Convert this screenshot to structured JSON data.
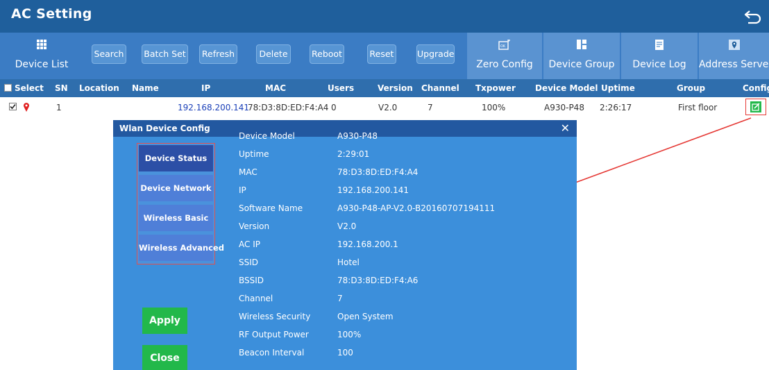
{
  "header": {
    "title": "AC Setting",
    "back_icon": "back-arrow-icon"
  },
  "toolbar": {
    "device_list": "Device List",
    "search": "Search",
    "batch_set": "Batch Set",
    "refresh": "Refresh",
    "delete": "Delete",
    "reboot": "Reboot",
    "reset": "Reset",
    "upgrade": "Upgrade",
    "zero_config": "Zero Config",
    "device_group": "Device Group",
    "device_log": "Device Log",
    "address_server": "Address Server"
  },
  "table": {
    "headers": {
      "select": "Select",
      "sn": "SN",
      "location": "Location",
      "name": "Name",
      "ip": "IP",
      "mac": "MAC",
      "users": "Users",
      "version": "Version",
      "channel": "Channel",
      "txpower": "Txpower",
      "model": "Device Model",
      "uptime": "Uptime",
      "group": "Group",
      "config": "Config"
    },
    "row": {
      "sn": "1",
      "ip": "192.168.200.141",
      "mac": "78:D3:8D:ED:F4:A4",
      "users": "0",
      "version": "V2.0",
      "channel": "7",
      "txpower": "100%",
      "model": "A930-P48",
      "uptime": "2:26:17",
      "group": "First floor"
    }
  },
  "modal": {
    "title": "Wlan Device Config",
    "close": "✕",
    "menu": [
      "Device Status",
      "Device Network",
      "Wireless Basic",
      "Wireless Advanced"
    ],
    "apply": "Apply",
    "close_btn": "Close",
    "fields": [
      {
        "label": "Device Model",
        "value": "A930-P48"
      },
      {
        "label": "Uptime",
        "value": "2:29:01"
      },
      {
        "label": "MAC",
        "value": "78:D3:8D:ED:F4:A4"
      },
      {
        "label": "IP",
        "value": "192.168.200.141"
      },
      {
        "label": "Software Name",
        "value": "A930-P48-AP-V2.0-B20160707194111"
      },
      {
        "label": "Version",
        "value": "V2.0"
      },
      {
        "label": "AC IP",
        "value": "192.168.200.1"
      },
      {
        "label": "SSID",
        "value": "Hotel"
      },
      {
        "label": "BSSID",
        "value": "78:D3:8D:ED:F4:A6"
      },
      {
        "label": "Channel",
        "value": "7"
      },
      {
        "label": "Wireless Security",
        "value": "Open System"
      },
      {
        "label": "RF Output Power",
        "value": "100%"
      },
      {
        "label": "Beacon Interval",
        "value": "100"
      }
    ]
  },
  "colors": {
    "header": "#1f5f9c",
    "toolbar": "#3b7cc4",
    "modal_body": "#3c8fdb",
    "accent_green": "#22b84a",
    "annotation_red": "#e53935"
  }
}
